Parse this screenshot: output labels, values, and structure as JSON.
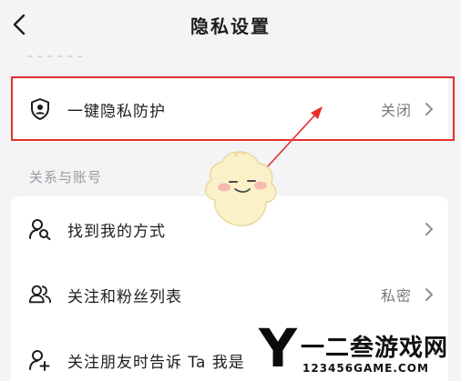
{
  "header": {
    "title": "隐私设置"
  },
  "top_setting": {
    "label": "一键隐私防护",
    "value": "关闭"
  },
  "section": {
    "label": "关系与账号"
  },
  "items": [
    {
      "label": "找到我的方式",
      "value": ""
    },
    {
      "label": "关注和粉丝列表",
      "value": "私密"
    },
    {
      "label": "关注朋友时告诉 Ta 我是",
      "value": ""
    }
  ],
  "watermark": {
    "brand": "Y",
    "name": "一二叁游戏网",
    "url": "123456GAME.COM"
  },
  "colors": {
    "accent_red": "#e5302d",
    "background": "#f4f4f6"
  }
}
